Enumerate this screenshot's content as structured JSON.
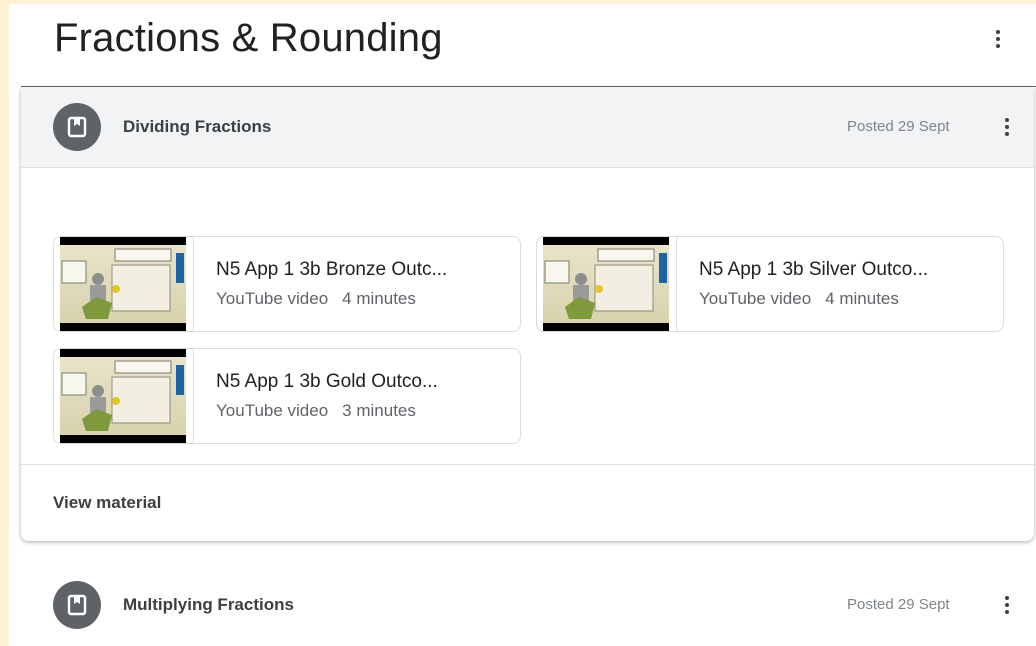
{
  "topic": {
    "title": "Fractions & Rounding"
  },
  "items": [
    {
      "icon": "material-book-icon",
      "title": "Dividing Fractions",
      "posted": "Posted 29 Sept",
      "attachments": [
        {
          "title": "N5 App 1 3b Bronze Outc...",
          "type": "YouTube video",
          "duration": "4 minutes"
        },
        {
          "title": "N5 App 1 3b Silver Outco...",
          "type": "YouTube video",
          "duration": "4 minutes"
        },
        {
          "title": "N5 App 1 3b Gold Outco...",
          "type": "YouTube video",
          "duration": "3 minutes"
        }
      ],
      "footer_link": "View material"
    },
    {
      "icon": "material-book-icon",
      "title": "Multiplying Fractions",
      "posted": "Posted 29 Sept"
    }
  ],
  "colors": {
    "page_border": "#fdf2d4",
    "header_bg": "#f1f3f4",
    "icon_circle": "#5f6368"
  }
}
